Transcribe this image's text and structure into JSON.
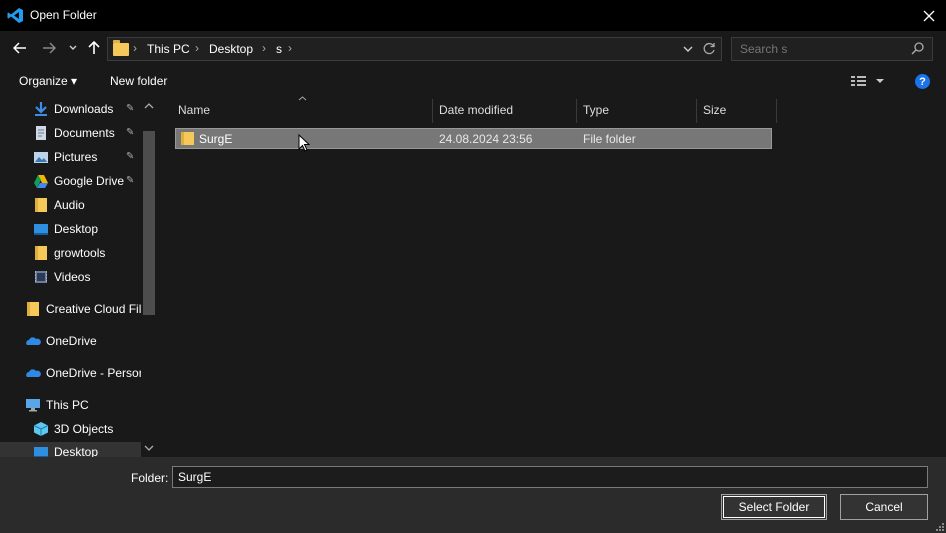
{
  "window": {
    "title": "Open Folder",
    "close_glyph": "✕"
  },
  "nav": {
    "back_glyph": "←",
    "forward_glyph": "→",
    "recent_glyph": "⌄",
    "up_glyph": "↑",
    "breadcrumb": [
      "This PC",
      "Desktop",
      "s"
    ],
    "separator": "›",
    "search_placeholder": "Search s",
    "refresh_glyph": "↻",
    "dropdown_glyph": "⌄"
  },
  "commands": {
    "organize": "Organize ▾",
    "new_folder": "New folder",
    "help_glyph": "?"
  },
  "sidebar": {
    "items": [
      {
        "label": "Downloads",
        "icon": "download-icon",
        "pinned": true
      },
      {
        "label": "Documents",
        "icon": "document-icon",
        "pinned": true
      },
      {
        "label": "Pictures",
        "icon": "pictures-icon",
        "pinned": true
      },
      {
        "label": "Google Drive",
        "icon": "google-drive-icon",
        "pinned": true
      },
      {
        "label": "Audio",
        "icon": "folder-icon",
        "pinned": false
      },
      {
        "label": "Desktop",
        "icon": "desktop-icon",
        "pinned": false
      },
      {
        "label": "growtools",
        "icon": "folder-icon",
        "pinned": false
      },
      {
        "label": "Videos",
        "icon": "videos-icon",
        "pinned": false
      },
      {
        "label": "Creative Cloud Fil",
        "icon": "folder-icon",
        "pinned": false
      },
      {
        "label": "OneDrive",
        "icon": "onedrive-icon",
        "pinned": false
      },
      {
        "label": "OneDrive - Persor",
        "icon": "onedrive-icon",
        "pinned": false
      },
      {
        "label": "This PC",
        "icon": "pc-icon",
        "pinned": false
      },
      {
        "label": "3D Objects",
        "icon": "3d-objects-icon",
        "pinned": false
      },
      {
        "label": "Desktop",
        "icon": "desktop-icon",
        "pinned": false
      }
    ],
    "pin_glyph": "📌"
  },
  "list": {
    "columns": [
      "Name",
      "Date modified",
      "Type",
      "Size"
    ],
    "rows": [
      {
        "name": "SurgE",
        "date": "24.08.2024 23:56",
        "type": "File folder",
        "size": ""
      }
    ]
  },
  "footer": {
    "folder_label": "Folder:",
    "folder_value": "SurgE",
    "select_button": "Select Folder",
    "cancel_button": "Cancel"
  }
}
